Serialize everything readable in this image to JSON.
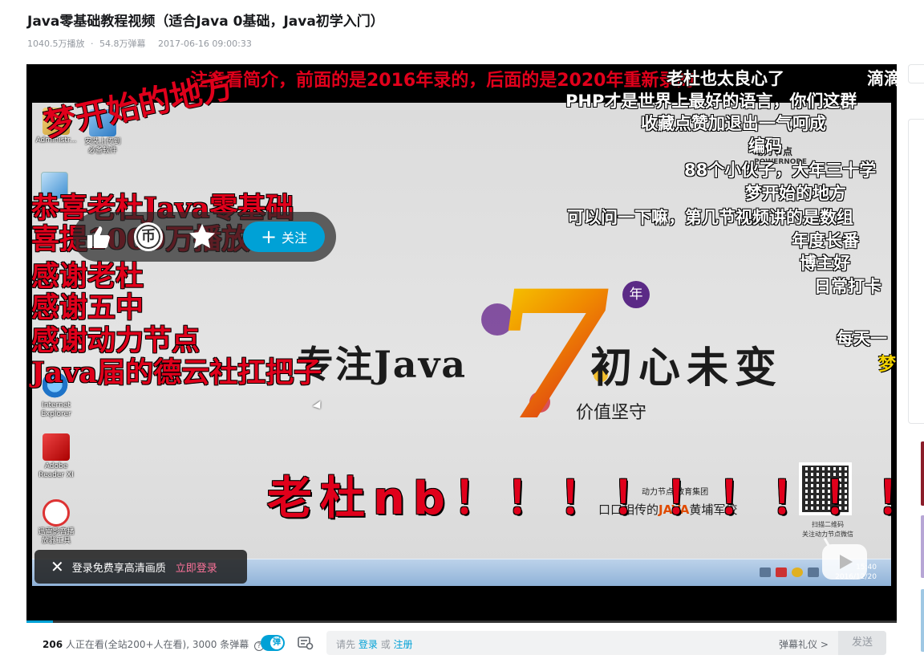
{
  "video": {
    "title": "Java零基础教程视频（适合Java 0基础，Java初学入门）",
    "plays": "1040.5万播放",
    "separator": "·",
    "danmaku_count": "54.8万弹幕",
    "publish_time": "2017-06-16 09:00:33"
  },
  "screen": {
    "desktop_icons": [
      {
        "label": "Administr...",
        "icon": "folder-user-icon"
      },
      {
        "label": "安装上传到\n必备软件",
        "icon": "installer-shortcut-icon"
      },
      {
        "label": "Internet\nExplorer",
        "icon": "internet-explorer-icon"
      },
      {
        "label": "Adobe\nReader XI",
        "icon": "adobe-reader-icon"
      },
      {
        "label": "迅雷影音播\n放器工具",
        "icon": "jia-app-icon"
      }
    ],
    "slogan_left": "专注Java",
    "big_number": "7",
    "year_badge": "年",
    "slogan_right": "初心未变",
    "value_text": "价值坚守",
    "company_small": "动力节点 教育集团",
    "school_line_prefix": "口口相传的",
    "school_line_highlight": "JAVA",
    "school_line_suffix": "黄埔军校",
    "brand_name": "动力节点",
    "brand_sub": "POWERNODE",
    "qr_caption_1": "扫描二维码",
    "qr_caption_2": "关注动力节点微信",
    "tray_time": "15:40",
    "tray_date": "2016/12/20"
  },
  "danmaku": {
    "top_1": "注意看简介，前面的是2016年录的，后面的是2020年重新录的",
    "top_2": "老杜也太良心了",
    "top_3": "滴滴",
    "right_1": "PHP才是世界上最好的语言，你们这群",
    "right_2": "收藏点赞加退出一气呵成",
    "right_3": "编码",
    "right_4": "88个小伙子，大年三十学",
    "right_5": "梦开始的地方",
    "right_6": "可以问一下嘛，第几节视频讲的是数组",
    "right_7": "年度长番",
    "right_8": "博主好",
    "right_9": "日常打卡",
    "right_10": "每天一",
    "right_11": "梦",
    "dream_red": "梦开始的地方",
    "congrats": [
      "恭喜老杜Java零基础",
      "喜提1000万播放",
      "感谢老杜",
      "感谢五中",
      "感谢动力节点",
      "Java届的德云社扛把子"
    ],
    "nb": "老杜nb！！！！！！！！！！"
  },
  "actions": {
    "like_icon": "thumb-up-icon",
    "coin_label": "币",
    "favorite_icon": "star-icon",
    "follow_plus": "+",
    "follow_label": "关注"
  },
  "toast": {
    "text": "登录免费享高清画质",
    "link": "立即登录"
  },
  "progress": {
    "fraction": 0.03
  },
  "danmaku_bar": {
    "viewers_count": "206",
    "viewers_text": "人正在看(全站200+人在看), 3000 条弹幕",
    "help": "?",
    "toggle_label": "弹",
    "placeholder_prefix": "请先",
    "login": "登录",
    "or": "或",
    "register": "注册",
    "etiquette": "弹幕礼仪 >",
    "send": "发送"
  },
  "colors": {
    "accent": "#00a1d6",
    "pink": "#fb7299",
    "danmaku_red": "#e0001b"
  }
}
